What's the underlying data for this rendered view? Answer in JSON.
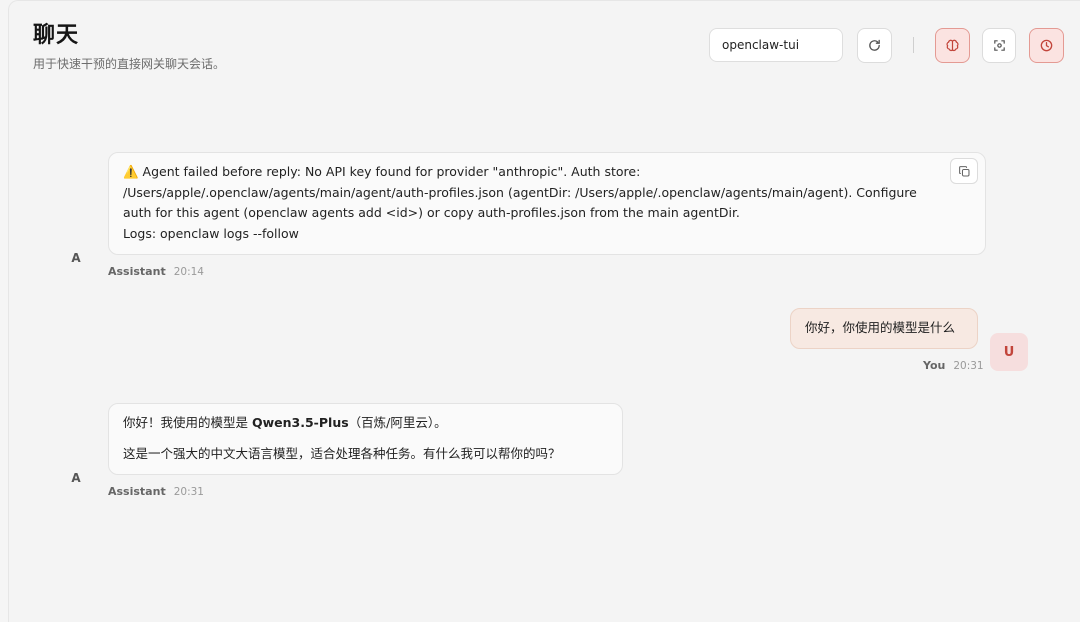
{
  "header": {
    "title": "聊天",
    "subtitle": "用于快速干预的直接网关聊天会话。",
    "session_value": "openclaw-tui"
  },
  "toolbar": {
    "icons": [
      "refresh-icon",
      "brain-icon",
      "focus-icon",
      "history-icon"
    ],
    "accent_color": "#e49a93"
  },
  "messages": [
    {
      "role": "assistant",
      "avatar": "A",
      "text_main": "⚠️ Agent failed before reply: No API key found for provider \"anthropic\". Auth store: /Users/apple/.openclaw/agents/main/agent/auth-profiles.json (agentDir: /Users/apple/.openclaw/agents/main/agent). Configure auth for this agent (openclaw agents add <id>) or copy auth-profiles.json from the main agentDir.",
      "text_logs": "Logs: openclaw logs --follow",
      "sender": "Assistant",
      "time": "20:14"
    },
    {
      "role": "user",
      "avatar": "U",
      "text": "你好，你使用的模型是什么",
      "sender": "You",
      "time": "20:31"
    },
    {
      "role": "assistant",
      "avatar": "A",
      "line1_pre": "你好！我使用的模型是 ",
      "line1_bold": "Qwen3.5-Plus",
      "line1_post": "（百炼/阿里云）。",
      "line2": "这是一个强大的中文大语言模型，适合处理各种任务。有什么我可以帮你的吗？",
      "sender": "Assistant",
      "time": "20:31"
    }
  ]
}
